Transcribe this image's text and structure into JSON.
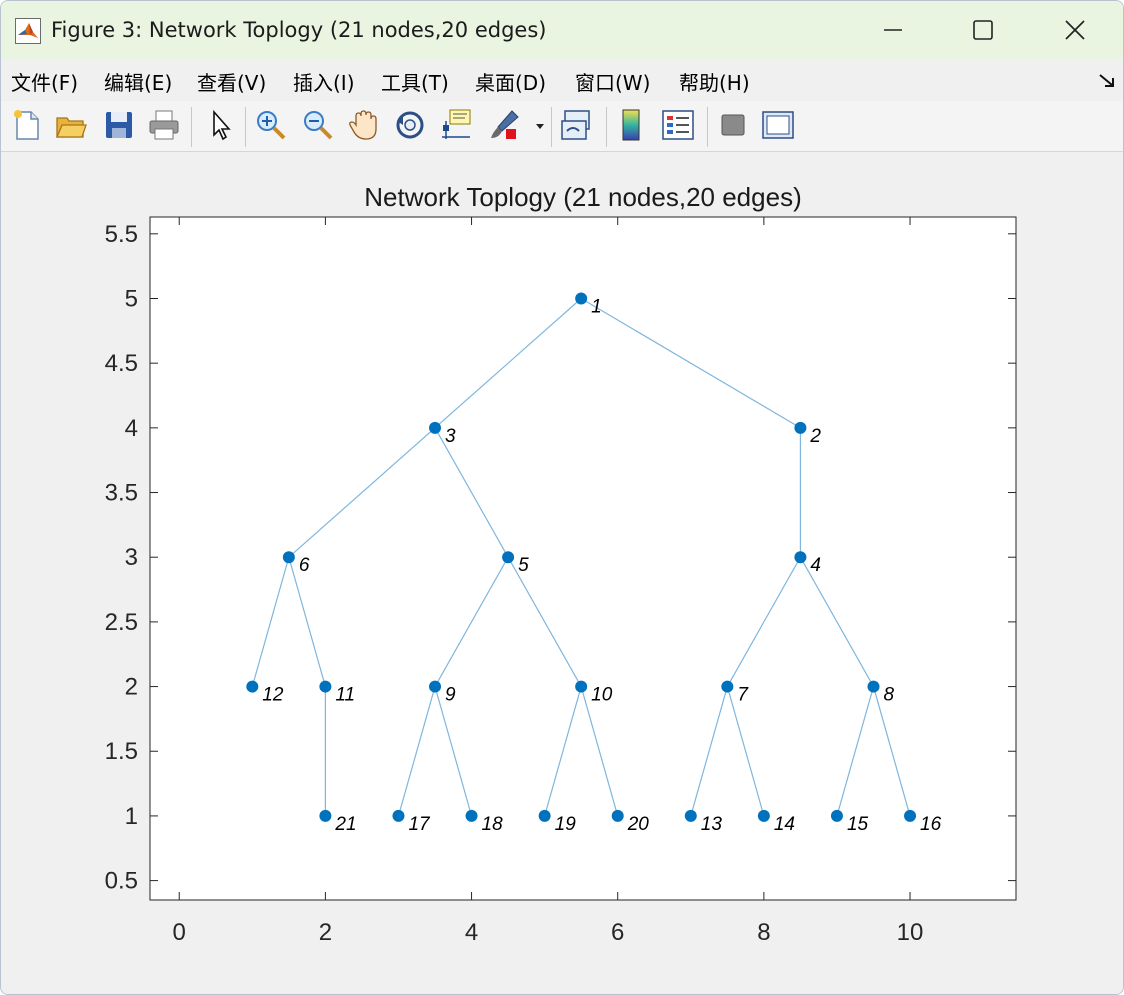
{
  "window": {
    "title": "Figure 3: Network Toplogy (21 nodes,20 edges)",
    "controls": [
      "minimize",
      "maximize",
      "close"
    ]
  },
  "menu": {
    "items": [
      "文件(F)",
      "编辑(E)",
      "查看(V)",
      "插入(I)",
      "工具(T)",
      "桌面(D)",
      "窗口(W)",
      "帮助(H)"
    ]
  },
  "toolbar": {
    "icons": [
      "new-figure-icon",
      "open-file-icon",
      "save-icon",
      "print-icon",
      "pointer-icon",
      "zoom-in-icon",
      "zoom-out-icon",
      "pan-hand-icon",
      "rotate-3d-icon",
      "data-cursor-icon",
      "brush-icon",
      "link-plot-icon",
      "colorbar-icon",
      "legend-icon",
      "hide-plot-tools-icon",
      "show-plot-tools-icon"
    ]
  },
  "colors": {
    "titlebar": "#e9f4e1",
    "node": "#0072bd",
    "edge": "#7fb6de",
    "axes_bg": "#ffffff",
    "figure_bg": "#f0f0f0"
  },
  "chart_data": {
    "type": "graph",
    "title": "Network Toplogy (21 nodes,20 edges)",
    "xlim": [
      -0.4,
      11.45
    ],
    "ylim": [
      0.35,
      5.63
    ],
    "xticks": [
      0,
      2,
      4,
      6,
      8,
      10
    ],
    "yticks": [
      0.5,
      1,
      1.5,
      2,
      2.5,
      3,
      3.5,
      4,
      4.5,
      5,
      5.5
    ],
    "grid": false,
    "nodes": [
      {
        "id": "1",
        "x": 5.5,
        "y": 5
      },
      {
        "id": "2",
        "x": 8.5,
        "y": 4
      },
      {
        "id": "3",
        "x": 3.5,
        "y": 4
      },
      {
        "id": "4",
        "x": 8.5,
        "y": 3
      },
      {
        "id": "5",
        "x": 4.5,
        "y": 3
      },
      {
        "id": "6",
        "x": 1.5,
        "y": 3
      },
      {
        "id": "7",
        "x": 7.5,
        "y": 2
      },
      {
        "id": "8",
        "x": 9.5,
        "y": 2
      },
      {
        "id": "9",
        "x": 3.5,
        "y": 2
      },
      {
        "id": "10",
        "x": 5.5,
        "y": 2
      },
      {
        "id": "11",
        "x": 2,
        "y": 2
      },
      {
        "id": "12",
        "x": 1,
        "y": 2
      },
      {
        "id": "13",
        "x": 7,
        "y": 1
      },
      {
        "id": "14",
        "x": 8,
        "y": 1
      },
      {
        "id": "15",
        "x": 9,
        "y": 1
      },
      {
        "id": "16",
        "x": 10,
        "y": 1
      },
      {
        "id": "17",
        "x": 3,
        "y": 1
      },
      {
        "id": "18",
        "x": 4,
        "y": 1
      },
      {
        "id": "19",
        "x": 5,
        "y": 1
      },
      {
        "id": "20",
        "x": 6,
        "y": 1
      },
      {
        "id": "21",
        "x": 2,
        "y": 1
      }
    ],
    "edges": [
      [
        "1",
        "3"
      ],
      [
        "1",
        "2"
      ],
      [
        "2",
        "4"
      ],
      [
        "3",
        "6"
      ],
      [
        "3",
        "5"
      ],
      [
        "4",
        "7"
      ],
      [
        "4",
        "8"
      ],
      [
        "5",
        "9"
      ],
      [
        "5",
        "10"
      ],
      [
        "6",
        "12"
      ],
      [
        "6",
        "11"
      ],
      [
        "11",
        "21"
      ],
      [
        "9",
        "17"
      ],
      [
        "9",
        "18"
      ],
      [
        "10",
        "19"
      ],
      [
        "10",
        "20"
      ],
      [
        "7",
        "13"
      ],
      [
        "7",
        "14"
      ],
      [
        "8",
        "15"
      ],
      [
        "8",
        "16"
      ]
    ]
  }
}
